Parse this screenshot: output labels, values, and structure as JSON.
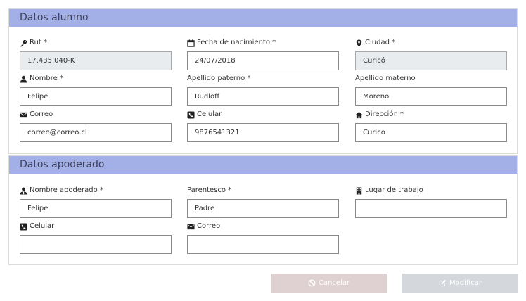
{
  "alumno": {
    "title": "Datos alumno",
    "rut_label": "Rut *",
    "rut_value": "17.435.040-K",
    "fecha_label": "Fecha de nacimiento *",
    "fecha_value": "24/07/2018",
    "ciudad_label": "Ciudad *",
    "ciudad_value": "Curicó",
    "nombre_label": "Nombre *",
    "nombre_value": "Felipe",
    "apellido_paterno_label": "Apellido paterno *",
    "apellido_paterno_value": "Rudloff",
    "apellido_materno_label": "Apellido materno",
    "apellido_materno_value": "Moreno",
    "correo_label": "Correo",
    "correo_value": "correo@correo.cl",
    "celular_label": "Celular",
    "celular_value": "9876541321",
    "direccion_label": "Dirección *",
    "direccion_value": "Curico"
  },
  "apoderado": {
    "title": "Datos apoderado",
    "nombre_label": "Nombre apoderado *",
    "nombre_value": "Felipe",
    "parentesco_label": "Parentesco *",
    "parentesco_value": "Padre",
    "lugar_label": "Lugar de trabajo",
    "lugar_value": "",
    "celular_label": "Celular",
    "celular_value": "",
    "correo_label": "Correo",
    "correo_value": ""
  },
  "actions": {
    "cancel_label": "Cancelar",
    "modify_label": "Modificar"
  }
}
